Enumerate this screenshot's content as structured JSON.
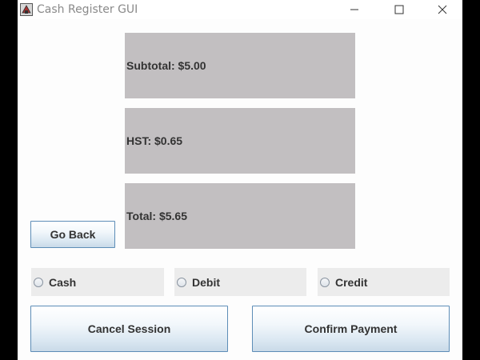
{
  "window": {
    "title": "Cash Register GUI",
    "controls": {
      "minimize_icon": "minimize-icon",
      "maximize_icon": "maximize-icon",
      "close_icon": "close-icon"
    }
  },
  "summary": {
    "subtotal": "Subtotal: $5.00",
    "hst": "HST: $0.65",
    "total": "Total: $5.65"
  },
  "buttons": {
    "go_back": "Go Back",
    "cancel_session": "Cancel Session",
    "confirm_payment": "Confirm Payment"
  },
  "payment_methods": [
    {
      "label": "Cash",
      "selected": false
    },
    {
      "label": "Debit",
      "selected": false
    },
    {
      "label": "Credit",
      "selected": false
    }
  ],
  "colors": {
    "panel_bg": "#c2bfc1",
    "button_border": "#5d8db7",
    "radio_box_bg": "#ececec",
    "text": "#333333"
  }
}
